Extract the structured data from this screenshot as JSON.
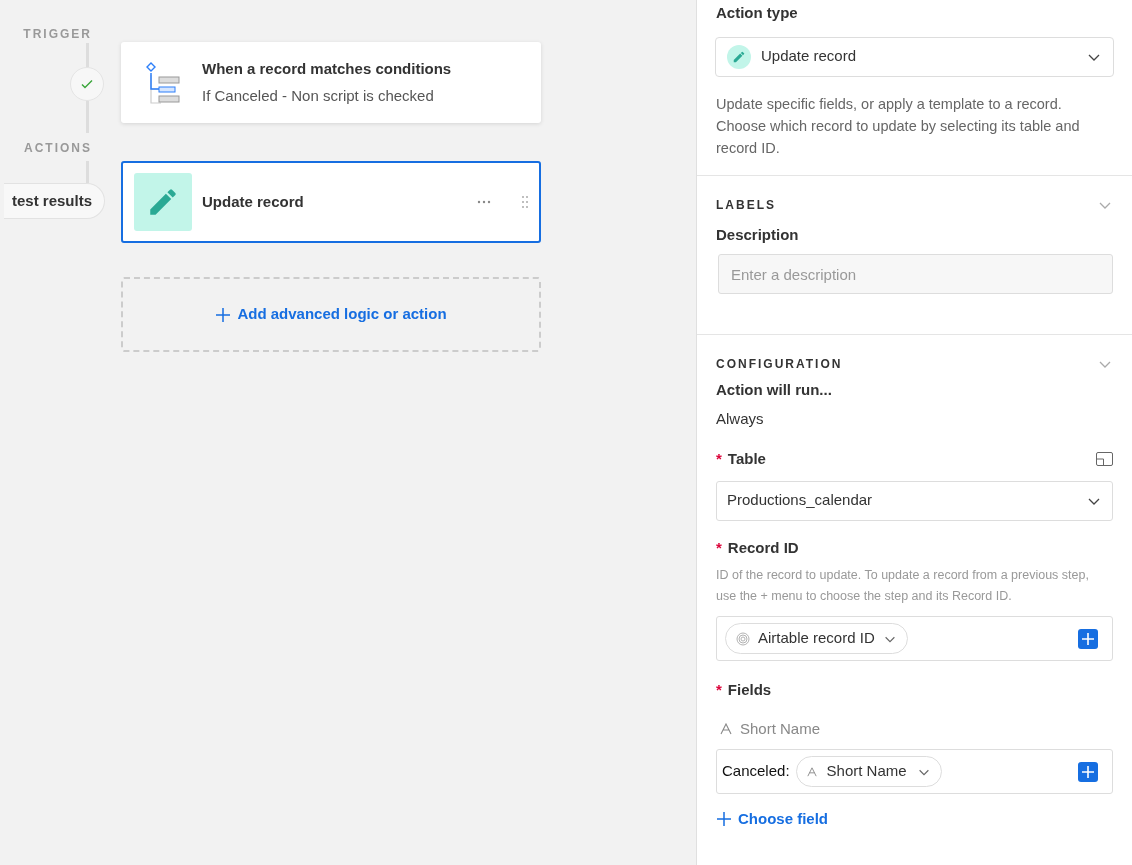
{
  "timeline": {
    "trigger_label": "TRIGGER",
    "trigger_done": true,
    "actions_label": "ACTIONS",
    "test_results_button": "test results"
  },
  "trigger_card": {
    "title": "When a record matches conditions",
    "subtitle": "If Canceled - Non script is checked"
  },
  "action_card": {
    "title": "Update record",
    "selected": true
  },
  "add_step": {
    "label": "Add advanced logic or action"
  },
  "panel": {
    "action_type": {
      "label": "Action type",
      "value": "Update record",
      "description": "Update specific fields, or apply a template to a record. Choose which record to update by selecting its table and record ID."
    },
    "labels": {
      "heading": "LABELS",
      "expanded": true,
      "description_label": "Description",
      "description_placeholder": "Enter a description"
    },
    "configuration": {
      "heading": "CONFIGURATION",
      "expanded": true,
      "run_label": "Action will run...",
      "run_value": "Always",
      "table": {
        "label": "Table",
        "required_mark": "*",
        "value": "Productions_calendar"
      },
      "record_id": {
        "label": "Record ID",
        "required_mark": "*",
        "help": "ID of the record to update. To update a record from a previous step, use the + menu to choose the step and its Record ID.",
        "token": "Airtable record ID"
      },
      "fields": {
        "label": "Fields",
        "required_mark": "*",
        "items": [
          {
            "name": "Short Name",
            "prefix": "Canceled:",
            "token": "Short Name"
          }
        ],
        "add_label": "Choose field"
      }
    }
  }
}
